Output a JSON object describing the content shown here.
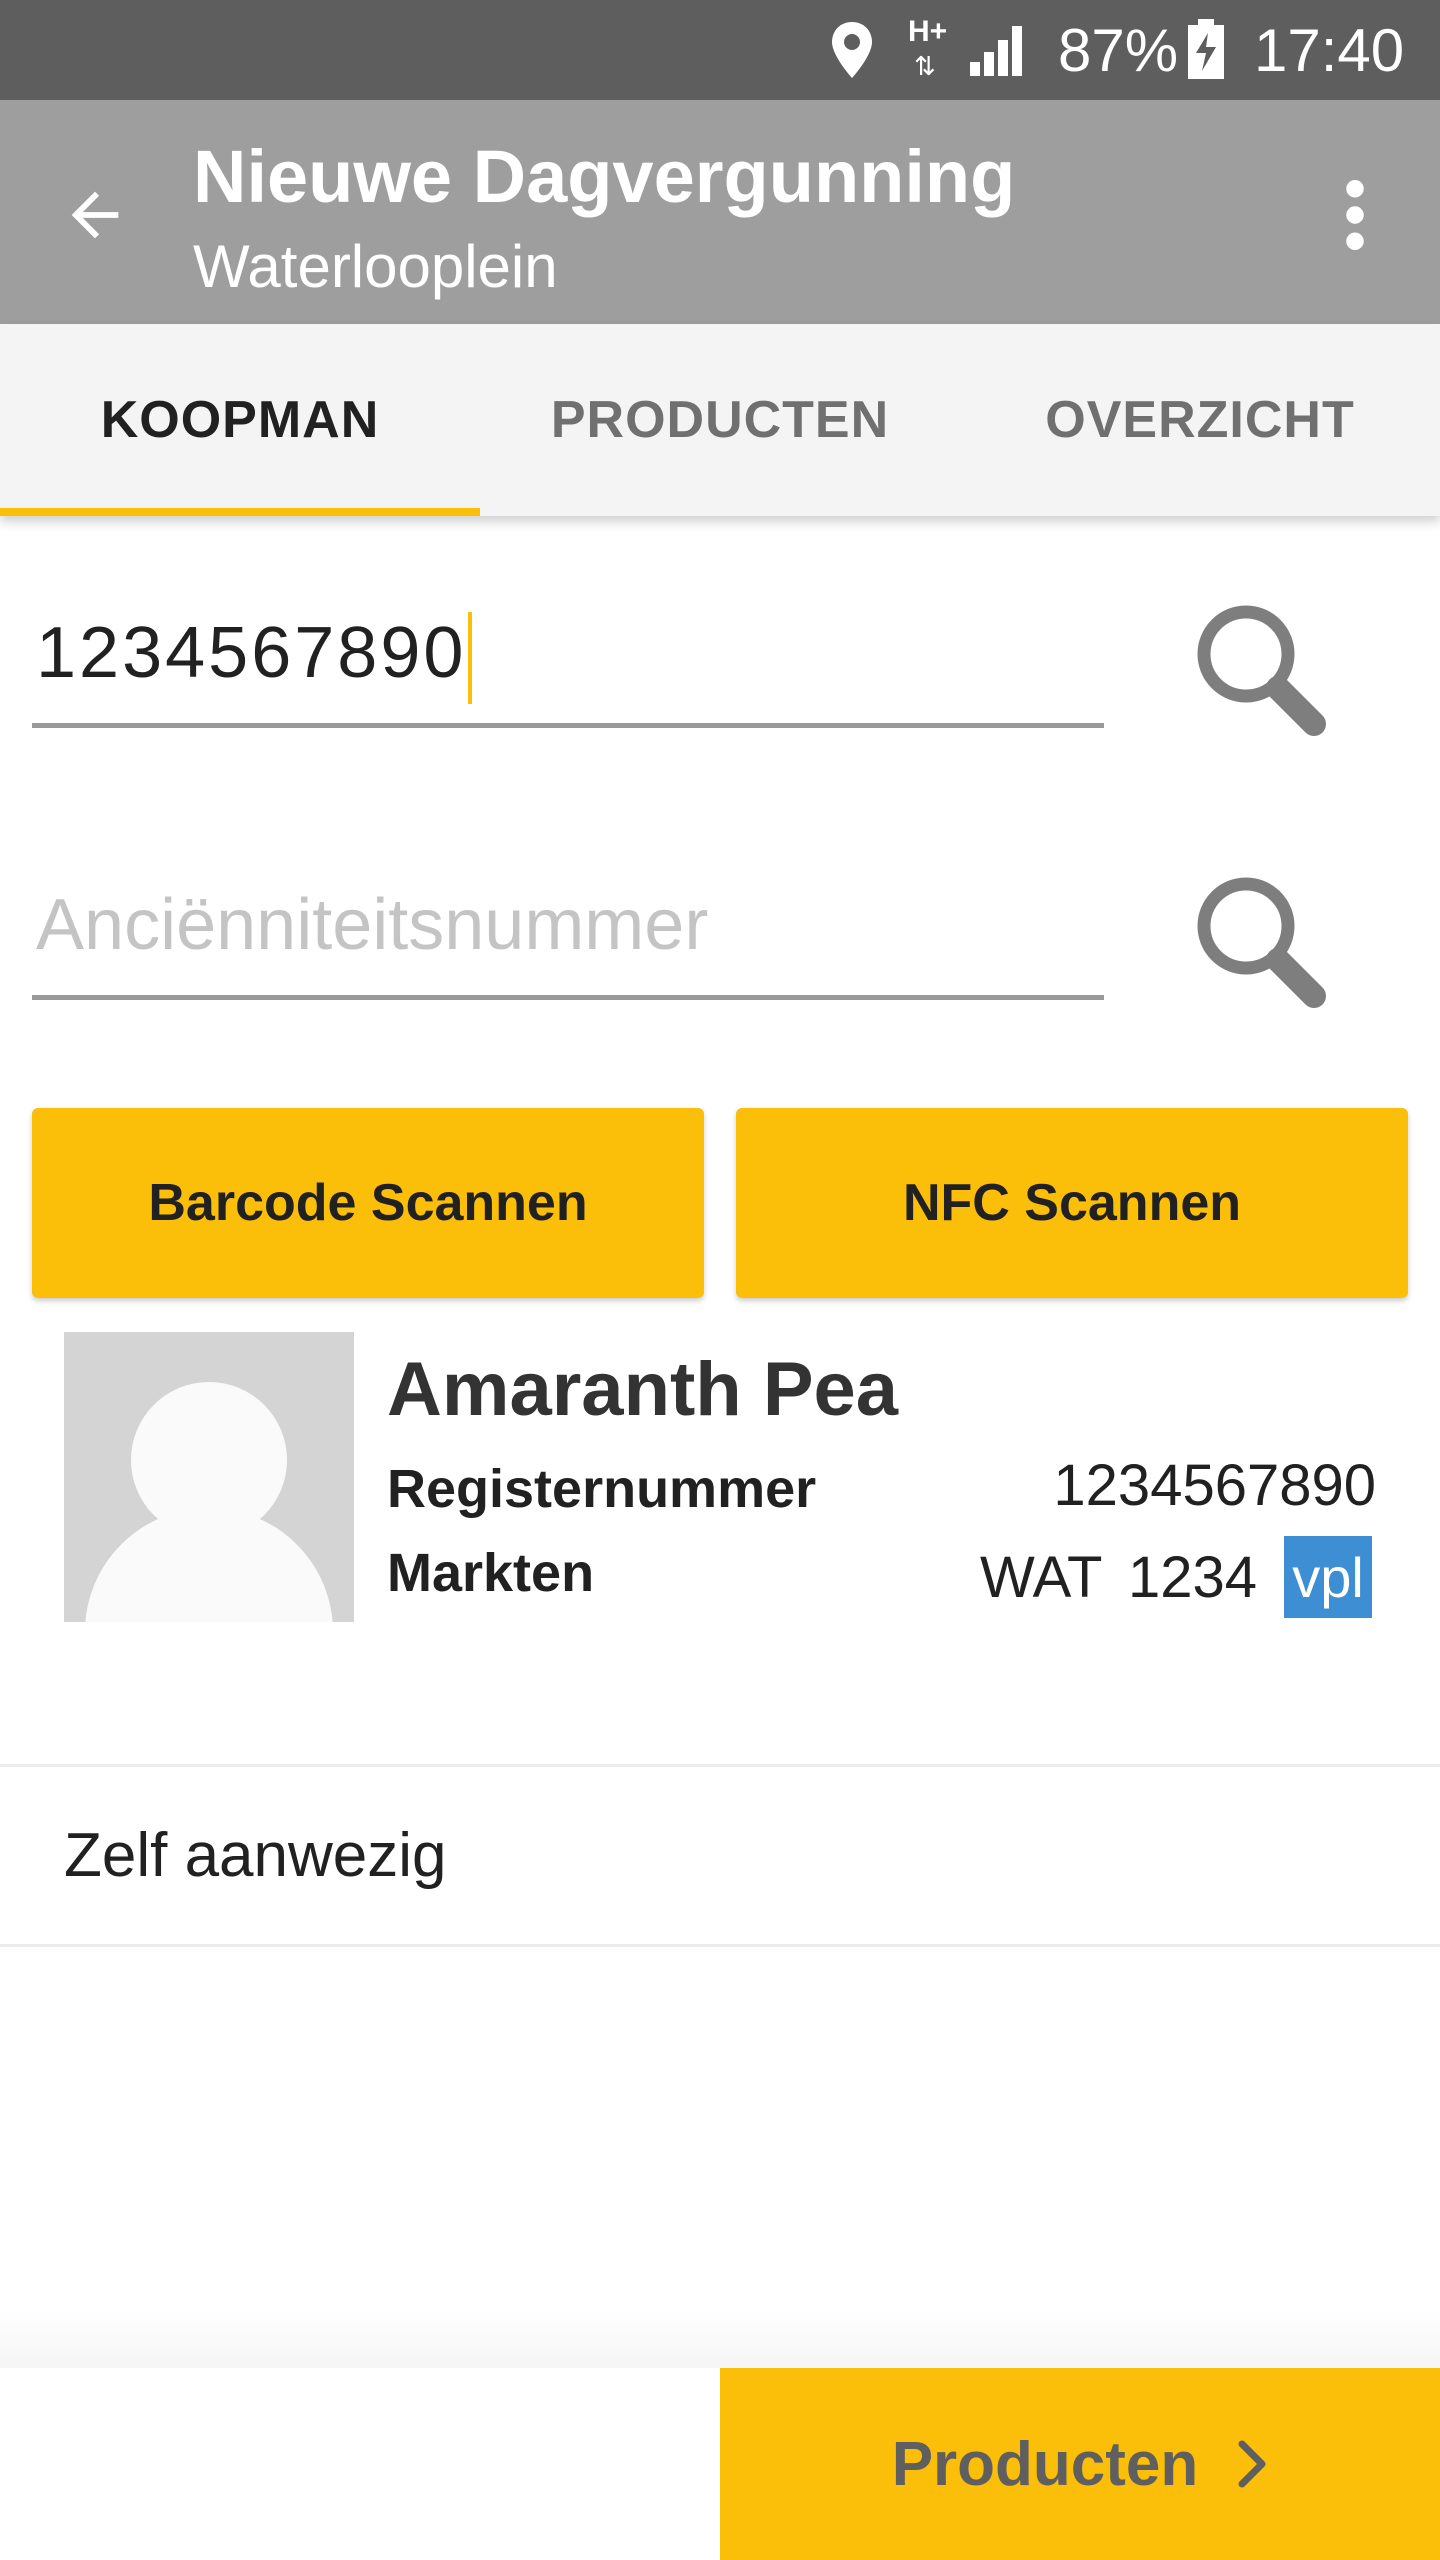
{
  "status_bar": {
    "network": "H+",
    "battery": "87%",
    "time": "17:40"
  },
  "app_bar": {
    "title": "Nieuwe Dagvergunning",
    "subtitle": "Waterlooplein"
  },
  "tabs": [
    {
      "label": "KOOPMAN",
      "active": true
    },
    {
      "label": "PRODUCTEN",
      "active": false
    },
    {
      "label": "OVERZICHT",
      "active": false
    }
  ],
  "form": {
    "registernummer_value": "1234567890",
    "ancienniteit_placeholder": "Anciënniteitsnummer",
    "barcode_button": "Barcode Scannen",
    "nfc_button": "NFC Scannen"
  },
  "koopman": {
    "name": "Amaranth Pea",
    "register_label": "Registernummer",
    "register_value": "1234567890",
    "markten_label": "Markten",
    "markt_code": "WAT",
    "markt_number": "1234",
    "markt_status": "vpl"
  },
  "checkbox": {
    "label": "Zelf aanwezig"
  },
  "footer": {
    "next_label": "Producten"
  },
  "colors": {
    "accent": "#fbbf09",
    "app_bar": "#9e9e9e",
    "status_bar": "#5e5e5e",
    "badge": "#3d8ed3"
  }
}
